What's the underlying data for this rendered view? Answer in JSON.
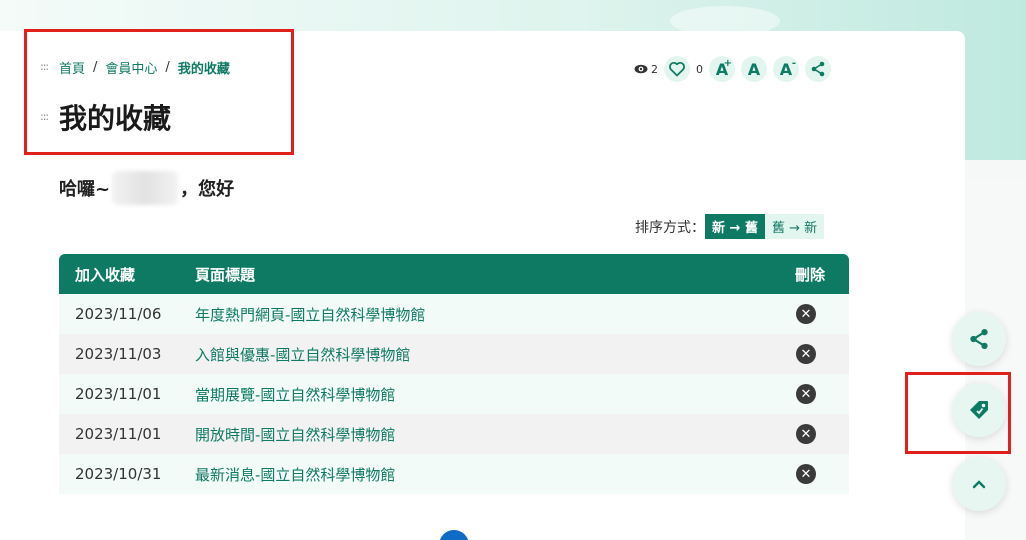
{
  "breadcrumb": {
    "home": "首頁",
    "member": "會員中心",
    "current": "我的收藏",
    "sep": "/"
  },
  "page": {
    "title": "我的收藏",
    "greeting_prefix": "哈囉~",
    "greeting_suffix": "，您好"
  },
  "tools": {
    "views": "2",
    "likes": "0",
    "font_large": "A",
    "font_normal": "A",
    "font_small": "A",
    "plus": "+",
    "minus": "-"
  },
  "sort": {
    "label": "排序方式：",
    "new_to_old": "新 → 舊",
    "old_to_new": "舊 → 新"
  },
  "table": {
    "headers": [
      "加入收藏",
      "頁面標題",
      "刪除"
    ],
    "rows": [
      {
        "date": "2023/11/06",
        "title": "年度熱門網頁-國立自然科學博物館"
      },
      {
        "date": "2023/11/03",
        "title": "入館與優惠-國立自然科學博物館"
      },
      {
        "date": "2023/11/01",
        "title": "當期展覽-國立自然科學博物館"
      },
      {
        "date": "2023/11/01",
        "title": "開放時間-國立自然科學博物館"
      },
      {
        "date": "2023/10/31",
        "title": "最新消息-國立自然科學博物館"
      }
    ]
  },
  "icons": {
    "delete": "✕",
    "eye": "eye-icon",
    "heart": "heart-icon",
    "share": "share-icon",
    "tag": "tag-icon",
    "up": "chevron-up-icon"
  },
  "colors": {
    "primary": "#0f7a63",
    "highlight": "#e0201a"
  }
}
